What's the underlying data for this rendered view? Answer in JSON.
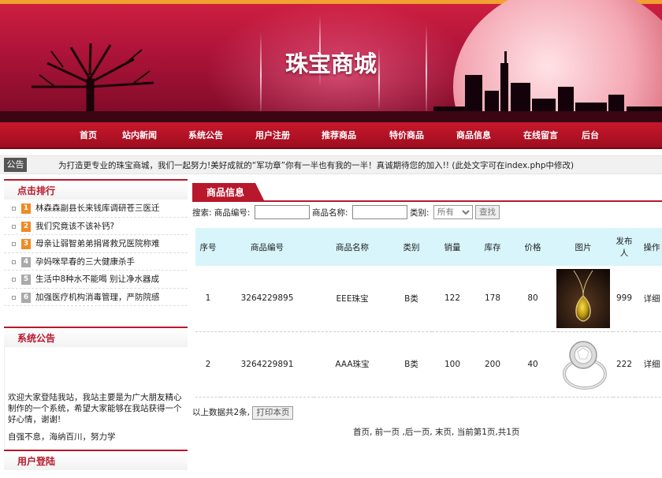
{
  "site": {
    "title": "珠宝商城"
  },
  "nav": [
    "首页",
    "站内新闻",
    "系统公告",
    "用户注册",
    "推荐商品",
    "特价商品",
    "商品信息",
    "在线留言",
    "后台"
  ],
  "notice": {
    "tag": "公告",
    "text": "为打造更专业的珠宝商城，我们一起努力!美好成就的“军功章”你有一半也有我的一半！真诚期待您的加入!! (此处文字可在index.php中修改)"
  },
  "sidebar": {
    "rank": {
      "title": "点击排行",
      "items": [
        {
          "n": "1",
          "text": "林森森副县长来钱库调研苍三医迁"
        },
        {
          "n": "2",
          "text": "我们究竟该不该补钙?"
        },
        {
          "n": "3",
          "text": "母亲让弱智弟弟捐肾救兄医院称难"
        },
        {
          "n": "4",
          "text": "孕妈咪早春的三大健康杀手"
        },
        {
          "n": "5",
          "text": "生活中8种水不能喝 别让净水器成"
        },
        {
          "n": "6",
          "text": "加强医疗机构消毒管理，严防院感"
        }
      ]
    },
    "announce": {
      "title": "系统公告",
      "p1": "欢迎大家登陆我站，我站主要是为广大朋友精心制作的一个系统，希望大家能够在我站获得一个好心情，谢谢!",
      "p2": "自强不息，海纳百川，努力学"
    },
    "login": {
      "title": "用户登陆"
    }
  },
  "main": {
    "tab": "商品信息",
    "search": {
      "code_label": "搜索: 商品编号:",
      "name_label": "商品名称:",
      "category_label": "类别:",
      "category_selected": "所有",
      "button": "查找"
    },
    "table": {
      "headers": [
        "序号",
        "商品编号",
        "商品名称",
        "类别",
        "销量",
        "库存",
        "价格",
        "图片",
        "发布人",
        "操作"
      ],
      "rows": [
        {
          "no": "1",
          "code": "3264229895",
          "name": "EEE珠宝",
          "category": "B类",
          "sales": "122",
          "stock": "178",
          "price": "80",
          "image": "amber-pendant-necklace",
          "publisher": "999",
          "action": "详细"
        },
        {
          "no": "2",
          "code": "3264229891",
          "name": "AAA珠宝",
          "category": "B类",
          "sales": "100",
          "stock": "200",
          "price": "40",
          "image": "diamond-ring",
          "publisher": "222",
          "action": "详细"
        }
      ]
    },
    "summary": "以上数据共2条,",
    "print_button": "打印本页",
    "pager": "首页, 前一页 ,后一页, 末页, 当前第1页,共1页"
  },
  "colors": {
    "brand_red": "#b8182c",
    "table_header": "#d7f5fb",
    "accent_orange": "#f08a24"
  }
}
